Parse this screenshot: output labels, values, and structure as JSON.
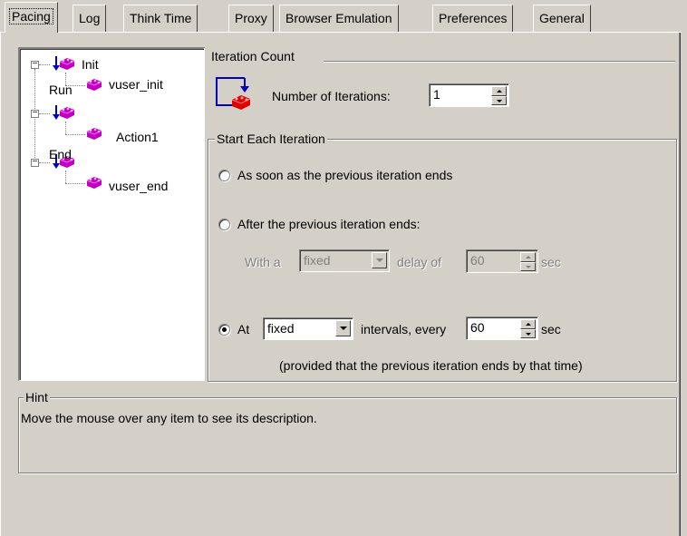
{
  "tabs": [
    {
      "label": "Pacing",
      "active": true
    },
    {
      "label": "Log"
    },
    {
      "label": "Think Time"
    },
    {
      "label": "Proxy"
    },
    {
      "label": "Browser Emulation"
    },
    {
      "label": "Preferences"
    },
    {
      "label": "General"
    }
  ],
  "tree": {
    "nodes": [
      {
        "label": "Init",
        "children": [
          "vuser_init"
        ]
      },
      {
        "label": "Run",
        "children": [
          "Action1"
        ]
      },
      {
        "label": "End",
        "children": [
          "vuser_end"
        ]
      }
    ]
  },
  "iteration_count": {
    "title": "Iteration Count",
    "number_label": "Number of Iterations:",
    "number_value": "1"
  },
  "start_each_iteration": {
    "title": "Start Each Iteration",
    "option1_label": "As soon as the previous iteration ends",
    "option2_label": "After the previous iteration ends:",
    "with_a": "With a",
    "delay_type": "fixed",
    "delay_of": "delay of",
    "delay_value": "60",
    "sec": "sec",
    "option3_at": "At",
    "interval_type": "fixed",
    "intervals_every": "intervals, every",
    "interval_value": "60",
    "sec2": "sec",
    "provided_note": "(provided that the previous iteration ends by that time)",
    "selected_option": 3
  },
  "hint": {
    "title": "Hint",
    "text": "Move the mouse over any item to see its description."
  },
  "colors": {
    "window_bg": "#d4d0c8",
    "field_bg": "#ffffff",
    "icon_magenta": "#c000c0",
    "icon_blue": "#0000c0",
    "icon_red": "#e00000"
  }
}
